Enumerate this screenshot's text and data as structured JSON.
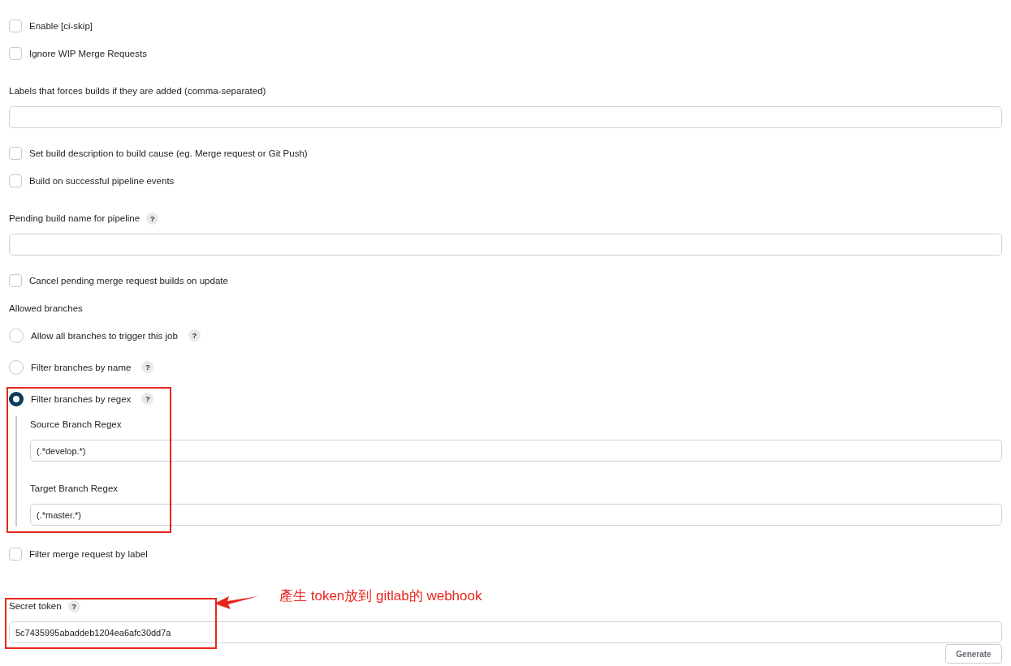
{
  "items": [
    {
      "kind": "checkbox",
      "label": "Enable [ci-skip]",
      "checked": false
    },
    {
      "kind": "checkbox",
      "label": "Ignore WIP Merge Requests",
      "checked": false
    },
    {
      "kind": "field",
      "label": "Labels that forces builds if they are added (comma-separated)"
    },
    {
      "kind": "checkbox",
      "label": "Set build description to build cause (eg. Merge request or Git Push)",
      "checked": false
    },
    {
      "kind": "checkbox",
      "label": "Build on successful pipeline events",
      "checked": false
    },
    {
      "kind": "field",
      "label": "Pending build name for pipeline",
      "help": "?"
    },
    {
      "kind": "checkbox",
      "label": "Cancel pending merge request builds on update",
      "checked": false
    },
    {
      "kind": "heading",
      "label": "Allowed branches"
    },
    {
      "kind": "radio",
      "label": "Allow all branches to trigger this job",
      "help": "?",
      "selected": false
    },
    {
      "kind": "radio",
      "label": "Filter branches by name",
      "help": "?",
      "selected": false
    },
    {
      "kind": "radio",
      "label": "Filter branches by regex",
      "help": "?",
      "selected": true,
      "children": [
        {
          "label": "Source Branch Regex",
          "value": "(.*develop.*)"
        },
        {
          "label": "Target Branch Regex",
          "value": "(.*master.*)"
        }
      ]
    },
    {
      "kind": "checkbox",
      "label": "Filter merge request by label",
      "checked": false
    },
    {
      "kind": "field",
      "label": "Secret token",
      "help": "?",
      "value": "5c7435995abaddeb1204ea6afc30dd7a",
      "button": "Generate"
    }
  ],
  "annotation": {
    "text": "產生 token放到 gitlab的 webhook"
  }
}
